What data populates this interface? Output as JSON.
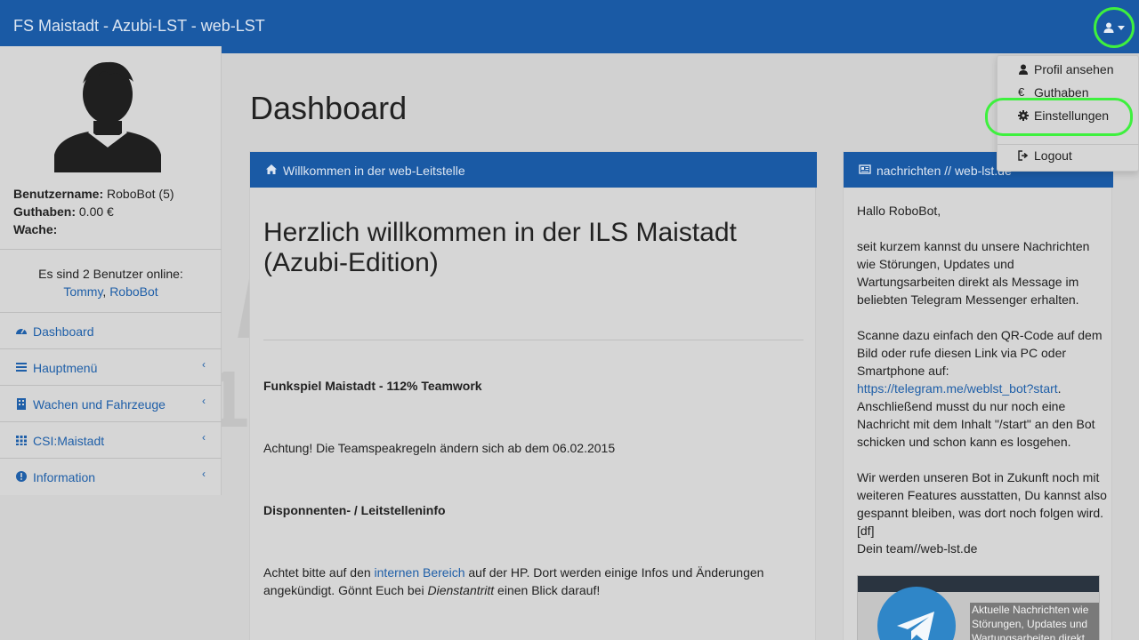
{
  "navbar": {
    "brand": "FS Maistadt - Azubi-LST - web-LST",
    "user_icon": "user-icon",
    "accent": "#1a5aa5"
  },
  "user_menu": {
    "items": [
      {
        "label": "Profil ansehen",
        "icon": "user-icon"
      },
      {
        "label": "Guthaben",
        "icon": "euro-icon"
      },
      {
        "label": "Einstellungen",
        "icon": "gear-icon"
      },
      {
        "label": "Logout",
        "icon": "logout-icon"
      }
    ],
    "highlight_color": "#3ef03e"
  },
  "sidebar": {
    "username_label": "Benutzername:",
    "username_value": "RoboBot (5)",
    "balance_label": "Guthaben:",
    "balance_value": "0.00 €",
    "station_label": "Wache:",
    "online_text": "Es sind 2 Benutzer online:",
    "online_users": [
      "Tommy",
      "RoboBot"
    ],
    "online_separator": ", ",
    "nav": [
      {
        "label": "Dashboard",
        "icon": "dashboard-icon",
        "has_chevron": false
      },
      {
        "label": "Hauptmenü",
        "icon": "bars-icon",
        "has_chevron": true
      },
      {
        "label": "Wachen und Fahrzeuge",
        "icon": "building-icon",
        "has_chevron": true
      },
      {
        "label": "CSI:Maistadt",
        "icon": "grid-icon",
        "has_chevron": true
      },
      {
        "label": "Information",
        "icon": "info-icon",
        "has_chevron": true
      }
    ],
    "chevron": "‹"
  },
  "main": {
    "title": "Dashboard",
    "welcome_panel": {
      "header": "Willkommen in der web-Leitstelle",
      "heading": "Herzlich willkommen in der ILS Maistadt (Azubi-Edition)",
      "funkspiel": "Funkspiel Maistadt - 112% Teamwork",
      "notice": "Achtung! Die Teamspeakregeln ändern sich ab dem 06.02.2015",
      "dispo_heading": "Disponnenten- / Leitstelleninfo",
      "info_before": "Achtet bitte auf den ",
      "info_link": "internen Bereich",
      "info_after": " auf der HP. Dort werden einige Infos und Änderungen angekündigt. Gönnt Euch bei ",
      "info_italic": "Dienstantritt",
      "info_end": " einen Blick darauf!"
    },
    "news_panel": {
      "header": "nachrichten // web-lst.de",
      "greeting": "Hallo RoboBot,",
      "para1": "seit kurzem kannst du unsere Nachrichten wie Störungen, Updates und Wartungsarbeiten direkt als Message im beliebten Telegram Messenger erhalten.",
      "para2_before": "Scanne dazu einfach den QR-Code auf dem Bild oder rufe diesen Link via PC oder Smartphone auf: ",
      "para2_link": "https://telegram.me/weblst_bot?start",
      "para2_after": ".",
      "para2b": "Anschließend musst du nur noch eine Nachricht mit dem Inhalt \"/start\" an den Bot schicken und schon kann es losgehen.",
      "para3": "Wir werden unseren Bot in Zukunft noch mit weiteren Features ausstatten, Du kannst also gespannt bleiben, was dort noch folgen wird. [df]",
      "signature": "Dein team//web-lst.de",
      "image_caption": "Aktuelle Nachrichten wie Störungen, Updates und Wartungsarbeiten direkt"
    }
  },
  "watermark": {
    "line1": "MAISTADT",
    "line2": "112% Teamwork"
  }
}
